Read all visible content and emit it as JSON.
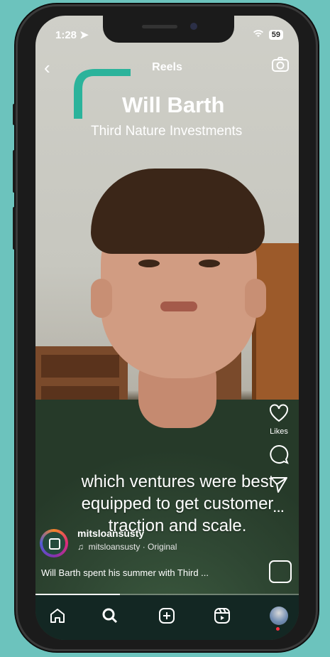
{
  "status": {
    "time": "1:28",
    "battery": "59"
  },
  "header": {
    "title": "Reels",
    "back_glyph": "‹"
  },
  "video": {
    "name": "Will Barth",
    "company": "Third Nature Investments",
    "caption": "which ventures were best equipped to get customer traction and scale."
  },
  "actions": {
    "likes_label": "Likes",
    "more_glyph": "···"
  },
  "account": {
    "handle": "mitsloansusty",
    "audio": "mitsloansusty · Original",
    "description": "Will Barth spent his summer with Third ..."
  },
  "progress": 0.32,
  "colors": {
    "accent": "#2bb39b",
    "background": "#6cc3bd",
    "tabbar": "#132723"
  },
  "icons": [
    "back-icon",
    "camera-icon",
    "heart-icon",
    "comment-icon",
    "share-icon",
    "more-icon",
    "remix-icon",
    "home-icon",
    "search-icon",
    "create-icon",
    "reels-icon",
    "profile-icon",
    "music-icon"
  ]
}
